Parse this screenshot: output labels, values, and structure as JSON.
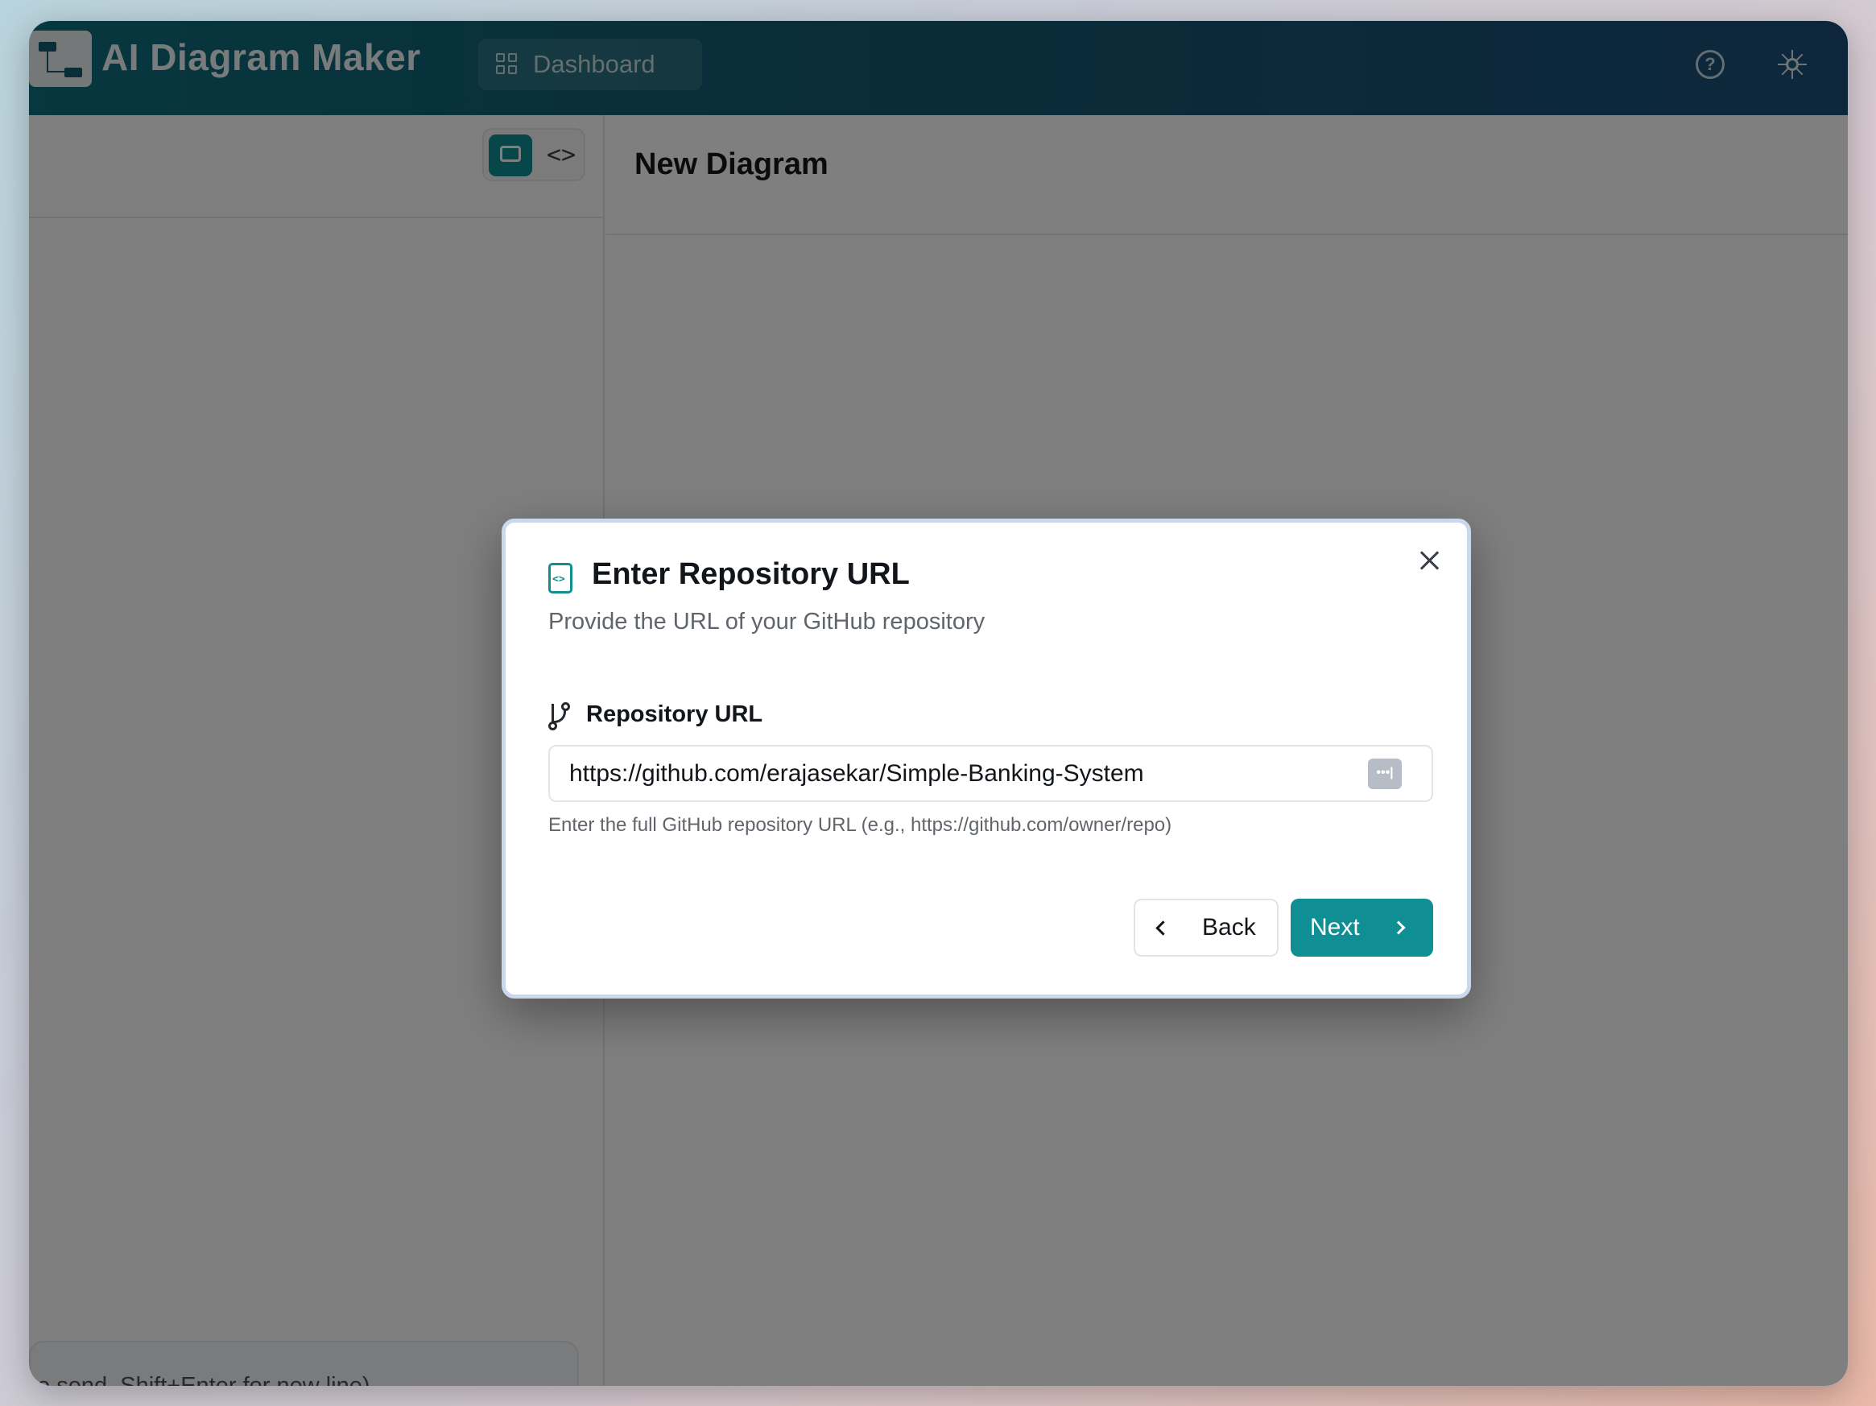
{
  "app": {
    "title": "AI Diagram Maker",
    "dashboard_label": "Dashboard",
    "accent_color": "#0f8f94"
  },
  "icons": {
    "logo": "diagram-logo-icon",
    "dashboard": "grid-icon",
    "help": "help-circle-icon",
    "theme": "sun-icon",
    "chat_mode": "chat-icon",
    "code_mode": "code-icon",
    "file_code": "file-code-icon",
    "branch": "git-branch-icon",
    "close": "close-icon",
    "password_manager": "password-dots-icon",
    "back": "chevron-left-icon",
    "next": "chevron-right-icon"
  },
  "left_pane": {
    "chat_input_hint": "to send, Shift+Enter for new line)"
  },
  "right_pane": {
    "title": "New Diagram"
  },
  "modal": {
    "title": "Enter Repository URL",
    "subtitle": "Provide the URL of your GitHub repository",
    "field_label": "Repository URL",
    "url_value": "https://github.com/erajasekar/Simple-Banking-System",
    "helper": "Enter the full GitHub repository URL (e.g., https://github.com/owner/repo)",
    "back_label": "Back",
    "next_label": "Next",
    "help_glyph": "?",
    "code_glyph": "<>",
    "password_glyph": "•••|"
  }
}
